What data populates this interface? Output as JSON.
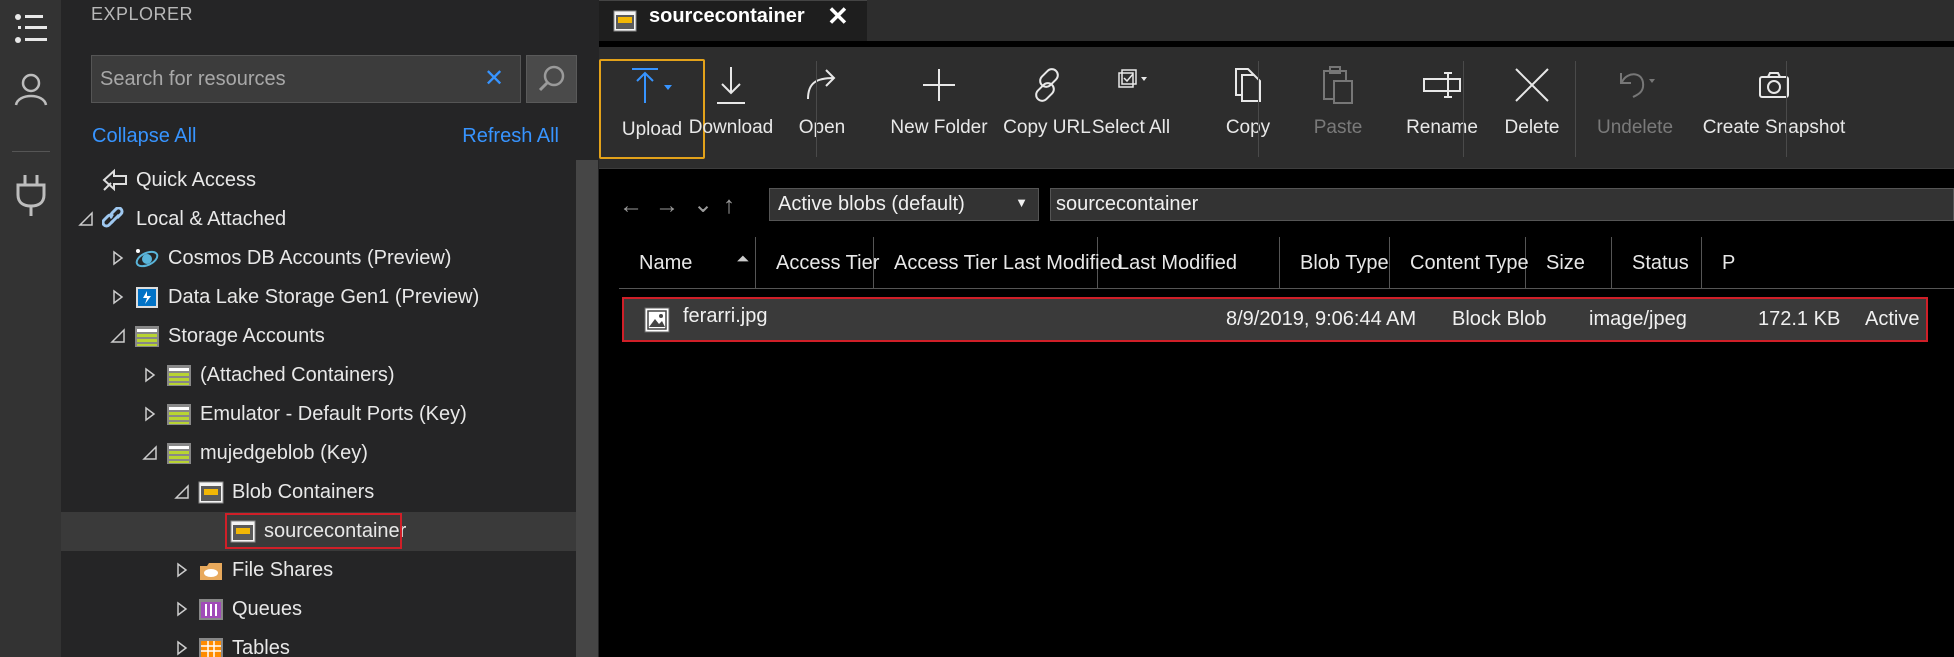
{
  "activity_bar": {
    "icons": [
      "explorer-list-icon",
      "account-icon",
      "plug-icon"
    ]
  },
  "explorer": {
    "title": "EXPLORER",
    "search": {
      "placeholder": "Search for resources",
      "value": ""
    },
    "collapse_all": "Collapse All",
    "refresh_all": "Refresh All",
    "tree": [
      {
        "label": "Quick Access",
        "icon": "quick-access-icon",
        "expander": "none",
        "selected": false
      },
      {
        "label": "Local & Attached",
        "icon": "link-icon",
        "expander": "expanded",
        "selected": false
      },
      {
        "label": "Cosmos DB Accounts (Preview)",
        "icon": "cosmos-db-icon",
        "expander": "collapsed",
        "selected": false
      },
      {
        "label": "Data Lake Storage Gen1 (Preview)",
        "icon": "data-lake-icon",
        "expander": "collapsed",
        "selected": false
      },
      {
        "label": "Storage Accounts",
        "icon": "storage-account-icon",
        "expander": "expanded",
        "selected": false
      },
      {
        "label": "(Attached Containers)",
        "icon": "storage-account-icon",
        "expander": "collapsed",
        "selected": false
      },
      {
        "label": "Emulator - Default Ports (Key)",
        "icon": "storage-account-icon",
        "expander": "collapsed",
        "selected": false
      },
      {
        "label": "mujedgeblob (Key)",
        "icon": "storage-account-icon",
        "expander": "expanded",
        "selected": false
      },
      {
        "label": "Blob Containers",
        "icon": "blob-containers-icon",
        "expander": "expanded",
        "selected": false
      },
      {
        "label": "sourcecontainer",
        "icon": "blob-container-icon",
        "expander": "none",
        "selected": true
      },
      {
        "label": "File Shares",
        "icon": "file-shares-icon",
        "expander": "collapsed",
        "selected": false
      },
      {
        "label": "Queues",
        "icon": "queues-icon",
        "expander": "collapsed",
        "selected": false
      },
      {
        "label": "Tables",
        "icon": "tables-icon",
        "expander": "collapsed",
        "selected": false
      }
    ]
  },
  "tab": {
    "label": "sourcecontainer",
    "close": "✕"
  },
  "toolbar": {
    "buttons": [
      {
        "label": "Upload",
        "icon": "upload-icon",
        "disabled": false
      },
      {
        "label": "Download",
        "icon": "download-icon",
        "disabled": false
      },
      {
        "label": "Open",
        "icon": "open-icon",
        "disabled": false
      },
      {
        "label": "New Folder",
        "icon": "new-folder-icon",
        "disabled": false
      },
      {
        "label": "Copy URL",
        "icon": "copy-url-icon",
        "disabled": false
      },
      {
        "label": "Select All",
        "icon": "select-all-icon",
        "disabled": false
      },
      {
        "label": "Copy",
        "icon": "copy-icon",
        "disabled": false
      },
      {
        "label": "Paste",
        "icon": "paste-icon",
        "disabled": true
      },
      {
        "label": "Rename",
        "icon": "rename-icon",
        "disabled": false
      },
      {
        "label": "Delete",
        "icon": "delete-icon",
        "disabled": false
      },
      {
        "label": "Undelete",
        "icon": "undelete-icon",
        "disabled": true
      },
      {
        "label": "Create Snapshot",
        "icon": "snapshot-icon",
        "disabled": false
      }
    ]
  },
  "navigation": {
    "view_select": "Active blobs (default)",
    "path": "sourcecontainer"
  },
  "grid": {
    "columns": [
      "Name",
      "Access Tier",
      "Access Tier Last Modified",
      "Last Modified",
      "Blob Type",
      "Content Type",
      "Size",
      "Status"
    ],
    "rows": [
      {
        "name": "ferarri.jpg",
        "access_tier": "",
        "access_tier_last_modified": "",
        "last_modified": "8/9/2019, 9:06:44 AM",
        "blob_type": "Block Blob",
        "content_type": "image/jpeg",
        "size": "172.1 KB",
        "status": "Active"
      }
    ]
  },
  "colors": {
    "accent": "#3794ff",
    "highlight": "#d01f28",
    "upload_border": "#e3a21a"
  }
}
